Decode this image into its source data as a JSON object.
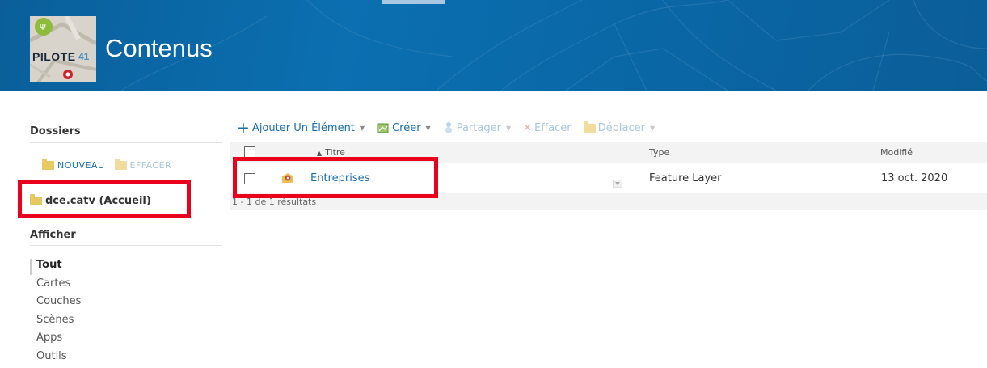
{
  "header": {
    "title": "Contenus",
    "logo": {
      "text": "PILOTE",
      "number": "41"
    },
    "colors": {
      "banner": "#0b6fb0",
      "accent": "#1a6fb0",
      "highlight": "#e8001c"
    }
  },
  "sidebar": {
    "folders_heading": "Dossiers",
    "new_label": "NOUVEAU",
    "delete_label": "EFFACER",
    "home_folder": "dce.catv (Accueil)",
    "view_heading": "Afficher",
    "filters": [
      "Tout",
      "Cartes",
      "Couches",
      "Scènes",
      "Apps",
      "Outils"
    ]
  },
  "toolbar": {
    "add_label": "Ajouter Un Élément",
    "create_label": "Créer",
    "share_label": "Partager",
    "delete_label": "Effacer",
    "move_label": "Déplacer"
  },
  "table": {
    "columns": {
      "title": "Titre",
      "type": "Type",
      "modified": "Modifié"
    },
    "rows": [
      {
        "title": "Entreprises",
        "type": "Feature Layer",
        "modified": "13 oct. 2020",
        "icon": "feature-layer-icon"
      }
    ],
    "results": "1 - 1 de 1 résultats"
  }
}
